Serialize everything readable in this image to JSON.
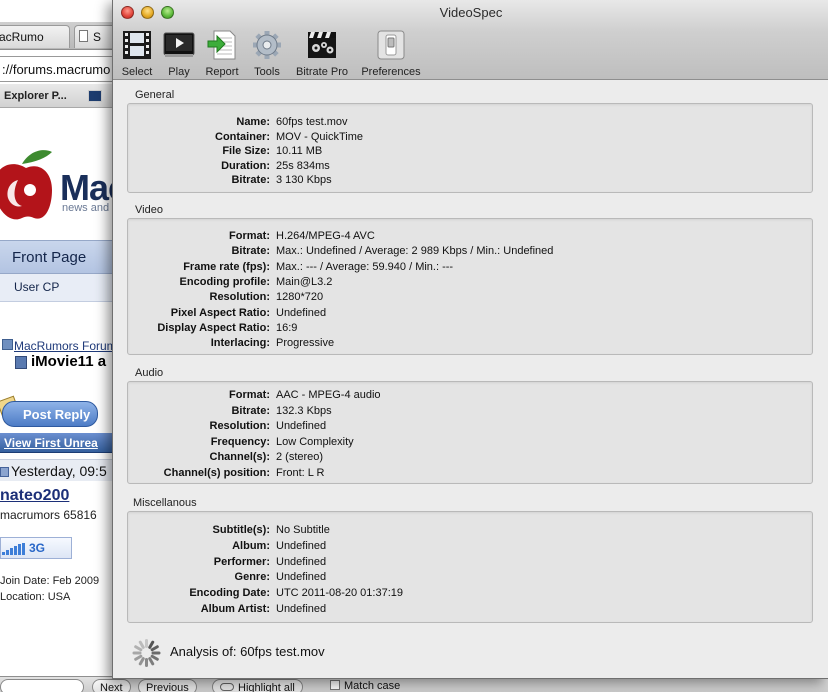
{
  "background_browser": {
    "tabs": [
      "acRumo",
      "S"
    ],
    "url": "://forums.macrumo",
    "bookmark": "Explorer P...",
    "logo_text": "Mac",
    "logo_sub": "news and",
    "nav_front_page": "Front Page",
    "nav_user_cp": "User CP",
    "breadcrumb": "MacRumors Forum",
    "thread_title": "iMovie11 a",
    "post_reply": "Post Reply",
    "view_first_unread": "View First Unrea",
    "post_date": "Yesterday, 09:5",
    "username": "nateo200",
    "user_rank": "macrumors 65816",
    "badge": "3G",
    "join_date": "Join Date: Feb 2009",
    "location": "Location: USA",
    "find_next": "Next",
    "find_previous": "Previous",
    "highlight_all": "Highlight all",
    "match_case": "Match case"
  },
  "window": {
    "title": "VideoSpec"
  },
  "toolbar": {
    "select": "Select",
    "play": "Play",
    "report": "Report",
    "tools": "Tools",
    "bitrate_pro": "Bitrate Pro",
    "preferences": "Preferences"
  },
  "sections": {
    "general": {
      "label": "General",
      "rows": [
        {
          "k": "Name:",
          "v": "60fps test.mov"
        },
        {
          "k": "Container:",
          "v": "MOV - QuickTime"
        },
        {
          "k": "File Size:",
          "v": "10.11 MB"
        },
        {
          "k": "Duration:",
          "v": "25s 834ms"
        },
        {
          "k": "Bitrate:",
          "v": "3 130 Kbps"
        }
      ]
    },
    "video": {
      "label": "Video",
      "rows": [
        {
          "k": "Format:",
          "v": "H.264/MPEG-4 AVC"
        },
        {
          "k": "Bitrate:",
          "v": "Max.: Undefined / Average: 2 989 Kbps / Min.: Undefined"
        },
        {
          "k": "Frame rate (fps):",
          "v": "Max.: --- / Average: 59.940 / Min.: ---"
        },
        {
          "k": "Encoding profile:",
          "v": "Main@L3.2"
        },
        {
          "k": "Resolution:",
          "v": "1280*720"
        },
        {
          "k": "Pixel Aspect Ratio:",
          "v": "Undefined"
        },
        {
          "k": "Display Aspect Ratio:",
          "v": "16:9"
        },
        {
          "k": "Interlacing:",
          "v": "Progressive"
        }
      ]
    },
    "audio": {
      "label": "Audio",
      "rows": [
        {
          "k": "Format:",
          "v": "AAC - MPEG-4 audio"
        },
        {
          "k": "Bitrate:",
          "v": "132.3 Kbps"
        },
        {
          "k": "Resolution:",
          "v": "Undefined"
        },
        {
          "k": "Frequency:",
          "v": "Low Complexity"
        },
        {
          "k": "Channel(s):",
          "v": "2 (stereo)"
        },
        {
          "k": "Channel(s) position:",
          "v": "Front: L R"
        }
      ]
    },
    "misc": {
      "label": "Miscellanous",
      "rows": [
        {
          "k": "Subtitle(s):",
          "v": "No Subtitle"
        },
        {
          "k": "Album:",
          "v": "Undefined"
        },
        {
          "k": "Performer:",
          "v": "Undefined"
        },
        {
          "k": "Genre:",
          "v": "Undefined"
        },
        {
          "k": "Encoding Date:",
          "v": "UTC 2011-08-20 01:37:19"
        },
        {
          "k": "Album Artist:",
          "v": "Undefined"
        }
      ]
    }
  },
  "status": {
    "text": "Analysis of:  60fps test.mov"
  }
}
